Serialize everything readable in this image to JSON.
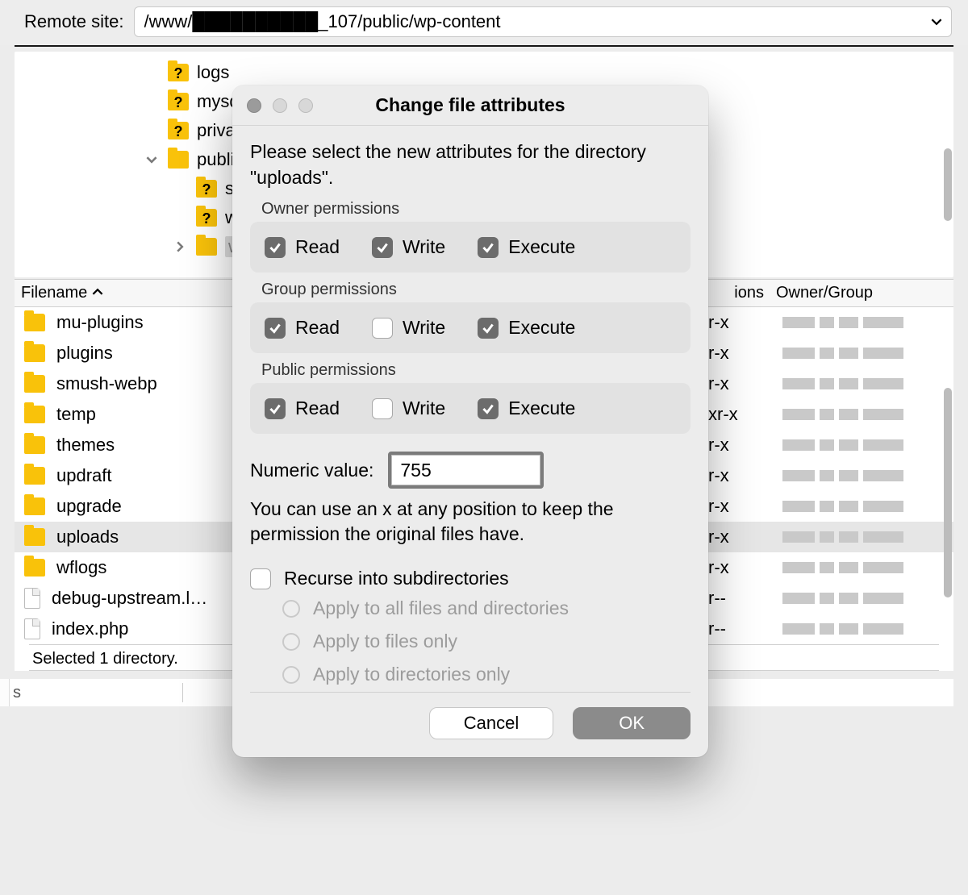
{
  "remote": {
    "label": "Remote site:",
    "path": "/www/██████████_107/public/wp-content"
  },
  "tree": {
    "items": [
      {
        "name": "logs",
        "type": "q"
      },
      {
        "name": "mysqled",
        "type": "q"
      },
      {
        "name": "private",
        "type": "q"
      },
      {
        "name": "public",
        "type": "folder",
        "expanded": true
      },
      {
        "name": "stagi",
        "type": "q",
        "sub": true
      },
      {
        "name": "wp-a",
        "type": "q",
        "sub": true
      },
      {
        "name": "wp-c",
        "type": "folder",
        "sub": true,
        "selected": true,
        "collapsed": true
      }
    ]
  },
  "list": {
    "columns": {
      "name": "Filename",
      "perm": "ions",
      "owner": "Owner/Group"
    },
    "rows": [
      {
        "name": "mu-plugins",
        "icon": "folder",
        "perm": "r-x"
      },
      {
        "name": "plugins",
        "icon": "folder",
        "perm": "r-x"
      },
      {
        "name": "smush-webp",
        "icon": "folder",
        "perm": "r-x"
      },
      {
        "name": "temp",
        "icon": "folder",
        "perm": "xr-x"
      },
      {
        "name": "themes",
        "icon": "folder",
        "perm": "r-x"
      },
      {
        "name": "updraft",
        "icon": "folder",
        "perm": "r-x"
      },
      {
        "name": "upgrade",
        "icon": "folder",
        "perm": "r-x"
      },
      {
        "name": "uploads",
        "icon": "folder",
        "perm": "r-x",
        "selected": true
      },
      {
        "name": "wflogs",
        "icon": "folder",
        "perm": "r-x"
      },
      {
        "name": "debug-upstream.l…",
        "icon": "file",
        "perm": "r--"
      },
      {
        "name": "index.php",
        "icon": "file",
        "perm": "r--"
      }
    ],
    "status": "Selected 1 directory."
  },
  "bottom": {
    "s": "s"
  },
  "dialog": {
    "title": "Change file attributes",
    "intro": "Please select the new attributes for the directory \"uploads\".",
    "groups": {
      "owner": {
        "label": "Owner permissions",
        "read": true,
        "write": true,
        "execute": true
      },
      "group": {
        "label": "Group permissions",
        "read": true,
        "write": false,
        "execute": true
      },
      "public": {
        "label": "Public permissions",
        "read": true,
        "write": false,
        "execute": true
      }
    },
    "perm_labels": {
      "read": "Read",
      "write": "Write",
      "execute": "Execute"
    },
    "numeric_label": "Numeric value:",
    "numeric_value": "755",
    "hint": "You can use an x at any position to keep the permission the original files have.",
    "recurse_label": "Recurse into subdirectories",
    "recurse_checked": false,
    "radios": {
      "all": "Apply to all files and directories",
      "files": "Apply to files only",
      "dirs": "Apply to directories only"
    },
    "buttons": {
      "cancel": "Cancel",
      "ok": "OK"
    }
  }
}
